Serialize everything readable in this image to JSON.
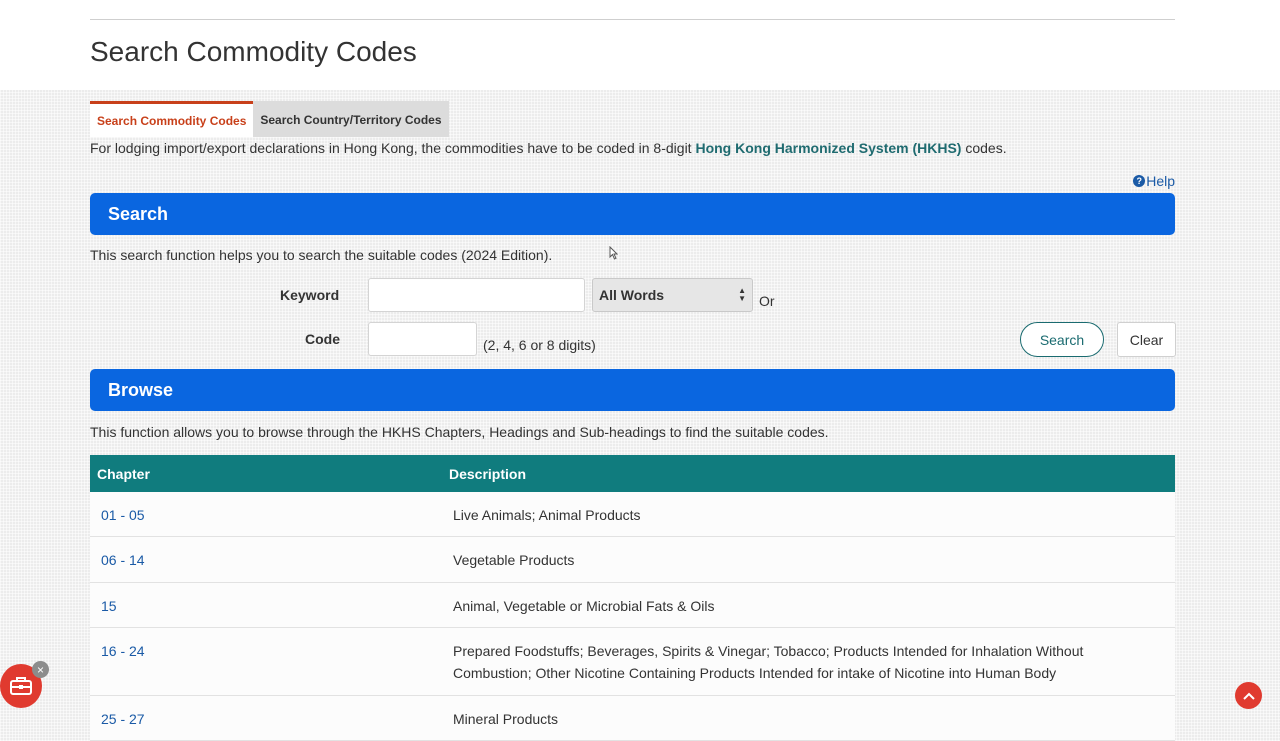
{
  "page": {
    "title": "Search Commodity Codes"
  },
  "tabs": [
    {
      "label": "Search Commodity Codes",
      "active": true
    },
    {
      "label": "Search Country/Territory Codes",
      "active": false
    }
  ],
  "intro": {
    "before": "For lodging import/export declarations in Hong Kong, the commodities have to be coded in 8-digit ",
    "link": "Hong Kong Harmonized System (HKHS)",
    "after": " codes."
  },
  "help": {
    "label": "Help",
    "icon": "help-icon"
  },
  "search": {
    "heading": "Search",
    "description": "This search function helps you to search the suitable codes (2024 Edition).",
    "keyword_label": "Keyword",
    "keyword_value": "",
    "match_select": "All Words",
    "or_text": "Or",
    "code_label": "Code",
    "code_value": "",
    "code_hint": "(2, 4, 6 or 8 digits)",
    "search_button": "Search",
    "clear_button": "Clear"
  },
  "browse": {
    "heading": "Browse",
    "description": "This function allows you to browse through the HKHS Chapters, Headings and Sub-headings to find the suitable codes.",
    "columns": [
      "Chapter",
      "Description"
    ],
    "rows": [
      {
        "chapter": "01 - 05",
        "description": "Live Animals; Animal Products"
      },
      {
        "chapter": "06 - 14",
        "description": "Vegetable Products"
      },
      {
        "chapter": "15",
        "description": "Animal, Vegetable or Microbial Fats & Oils"
      },
      {
        "chapter": "16 - 24",
        "description": "Prepared Foodstuffs; Beverages, Spirits & Vinegar; Tobacco; Products Intended for Inhalation Without Combustion; Other Nicotine Containing Products Intended for intake of Nicotine into Human Body"
      },
      {
        "chapter": "25 - 27",
        "description": "Mineral Products"
      }
    ]
  },
  "colors": {
    "accent_blue": "#0a66e0",
    "table_header": "#107c7e",
    "tab_active": "#c8401a",
    "floating_red": "#e03a2f"
  }
}
